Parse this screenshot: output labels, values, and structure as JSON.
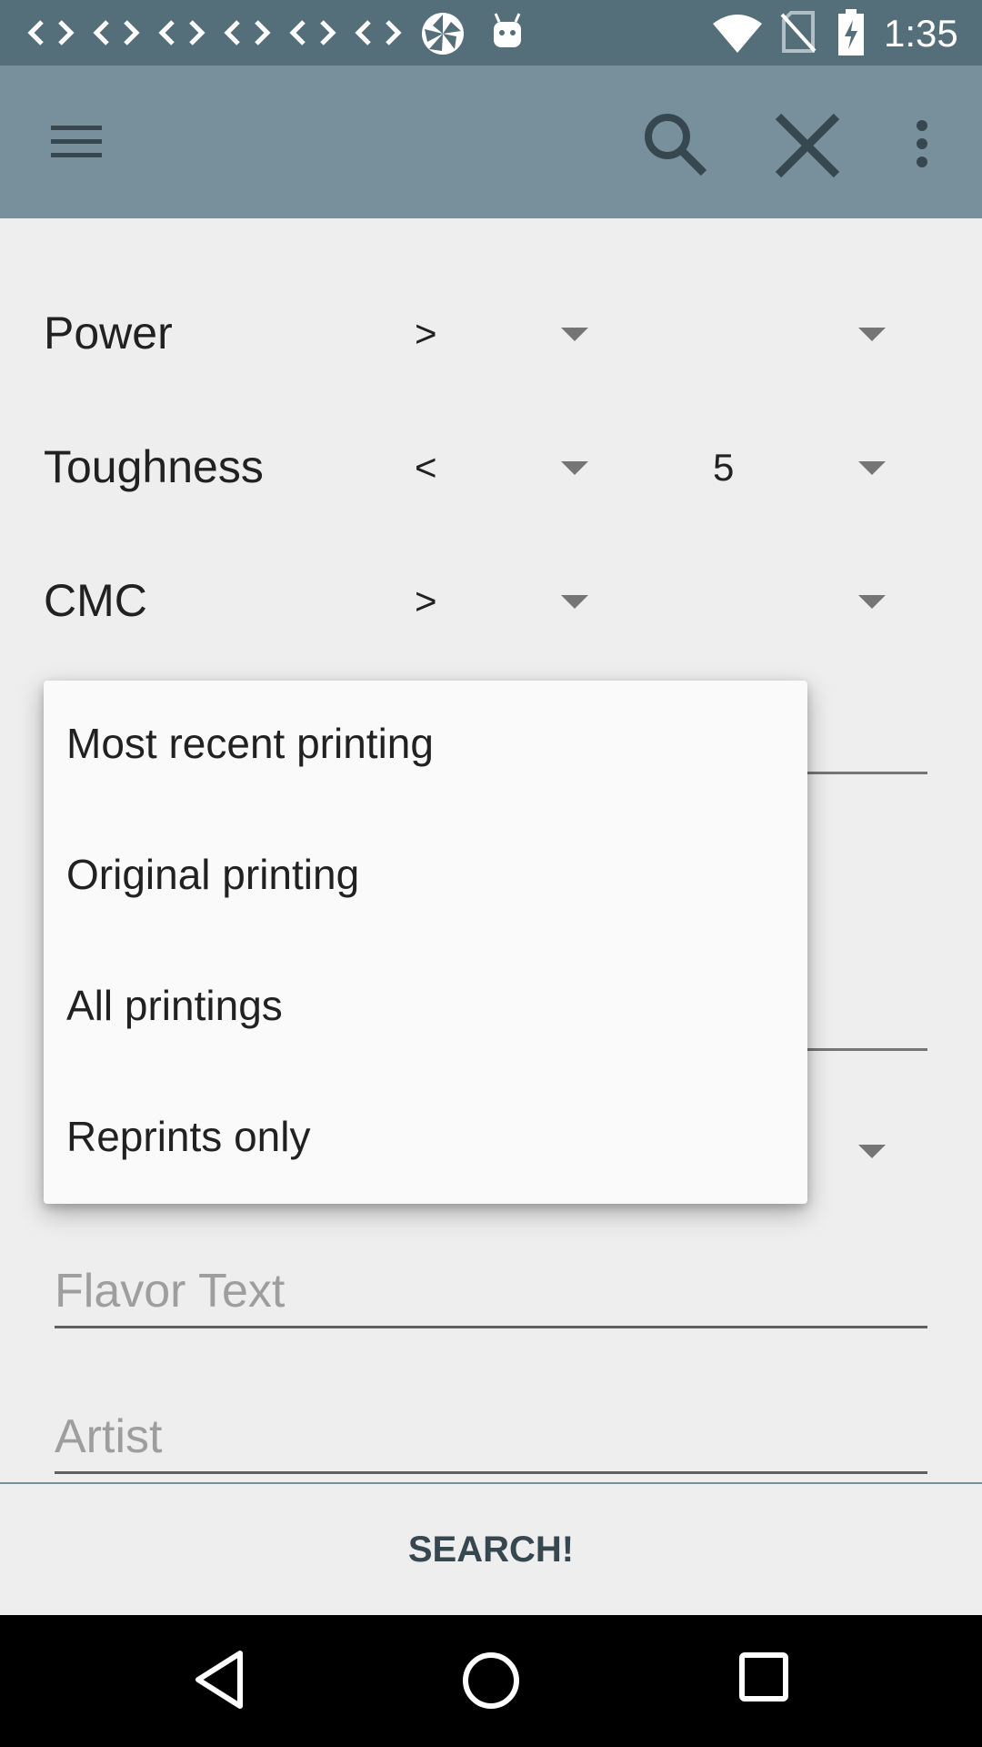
{
  "status_bar": {
    "time": "1:35",
    "left_icons": [
      "code-icon",
      "code-icon",
      "code-icon",
      "code-icon",
      "code-icon",
      "code-icon",
      "pinwheel-icon",
      "android-icon"
    ],
    "right_icons": [
      "wifi-icon",
      "no-sim-icon",
      "battery-charging-icon"
    ]
  },
  "toolbar": {
    "menu_icon": "menu-icon",
    "search_icon": "search-icon",
    "clear_icon": "close-icon",
    "overflow_icon": "more-vert-icon"
  },
  "filters": {
    "power": {
      "label": "Power",
      "comparator": ">",
      "value": ""
    },
    "toughness": {
      "label": "Toughness",
      "comparator": "<",
      "value": "5"
    },
    "cmc": {
      "label": "CMC",
      "comparator": ">",
      "value": ""
    }
  },
  "printing_dropdown": {
    "options": [
      "Most recent printing",
      "Original printing",
      "All printings",
      "Reprints only"
    ]
  },
  "fields": {
    "flavor_text": {
      "placeholder": "Flavor Text",
      "value": ""
    },
    "artist": {
      "placeholder": "Artist",
      "value": ""
    }
  },
  "search_button": {
    "label": "SEARCH!"
  },
  "nav_bar": {
    "back_icon": "back-icon",
    "home_icon": "home-icon",
    "recents_icon": "recents-icon"
  },
  "colors": {
    "status_bar": "#546e7a",
    "toolbar": "#78909c",
    "background": "#eeeeee",
    "accent_text": "#37474f"
  }
}
